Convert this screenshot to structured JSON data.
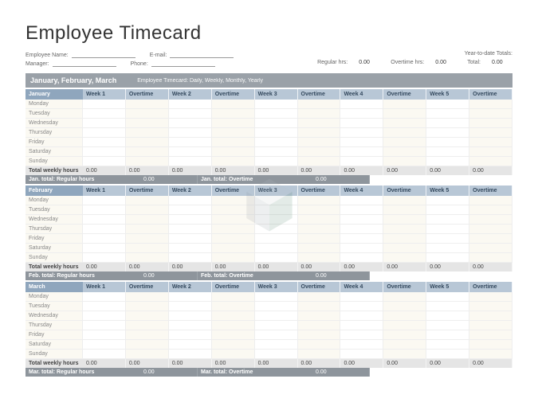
{
  "title": "Employee Timecard",
  "meta": {
    "employee_name_label": "Employee Name:",
    "manager_label": "Manager:",
    "email_label": "E-mail:",
    "phone_label": "Phone:",
    "ytd_label": "Year-to-date Totals:",
    "reg_label": "Regular hrs:",
    "reg_val": "0.00",
    "ot_label": "Overtime hrs:",
    "ot_val": "0.00",
    "total_label": "Total:",
    "total_val": "0.00"
  },
  "banner": {
    "quarter": "January, February, March",
    "sub": "Employee Timecard: Daily, Weekly, Monthly, Yearly"
  },
  "columns": [
    "Week 1",
    "Overtime",
    "Week 2",
    "Overtime",
    "Week 3",
    "Overtime",
    "Week 4",
    "Overtime",
    "Week 5",
    "Overtime"
  ],
  "days": [
    "Monday",
    "Tuesday",
    "Wednesday",
    "Thursday",
    "Friday",
    "Saturday",
    "Sunday"
  ],
  "totals_label": "Total weekly hours",
  "zero": "0.00",
  "months": [
    {
      "name": "January",
      "sum_reg": "Jan. total: Regular hours",
      "sum_ot": "Jan. total: Overtime"
    },
    {
      "name": "February",
      "sum_reg": "Feb. total: Regular hours",
      "sum_ot": "Feb. total: Overtime"
    },
    {
      "name": "March",
      "sum_reg": "Mar. total: Regular hours",
      "sum_ot": "Mar. total: Overtime"
    }
  ]
}
